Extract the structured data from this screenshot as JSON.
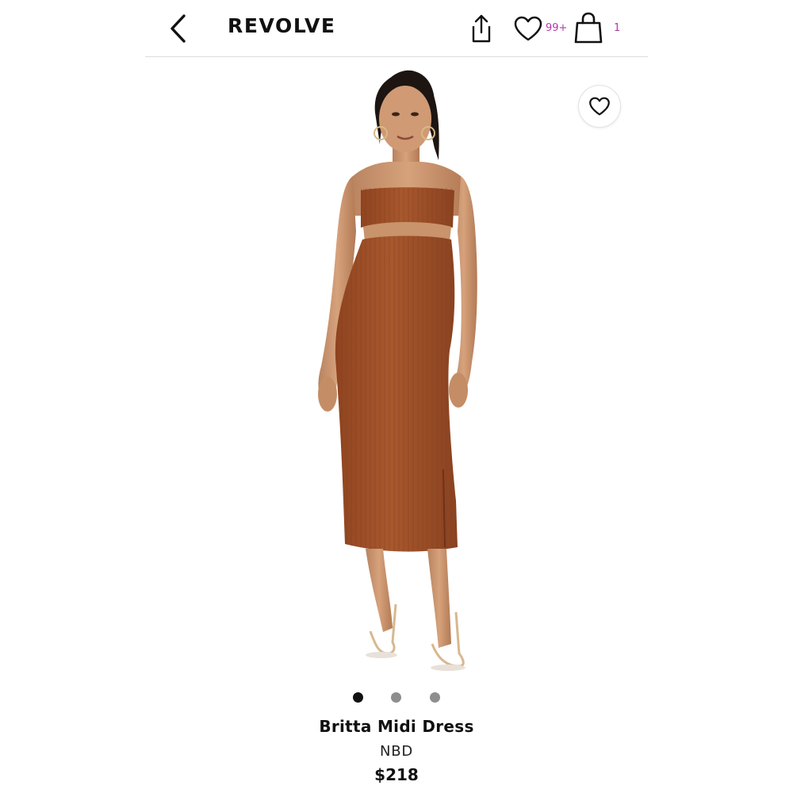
{
  "header": {
    "brand": "REVOLVE",
    "wishlist_count": "99+",
    "bag_count": "1",
    "icons": {
      "back": "chevron-left-icon",
      "share": "share-icon",
      "wishlist": "heart-outline-icon",
      "bag": "shopping-bag-icon"
    }
  },
  "product": {
    "name": "Britta Midi Dress",
    "brand": "NBD",
    "price": "$218",
    "dress_color": "#a2552c",
    "image_alt": "model-photo",
    "carousel": {
      "total": 3,
      "active_index": 0
    }
  },
  "colors": {
    "accent_count": "#b03aa8",
    "text": "#111111",
    "divider": "#dcdcdc"
  }
}
